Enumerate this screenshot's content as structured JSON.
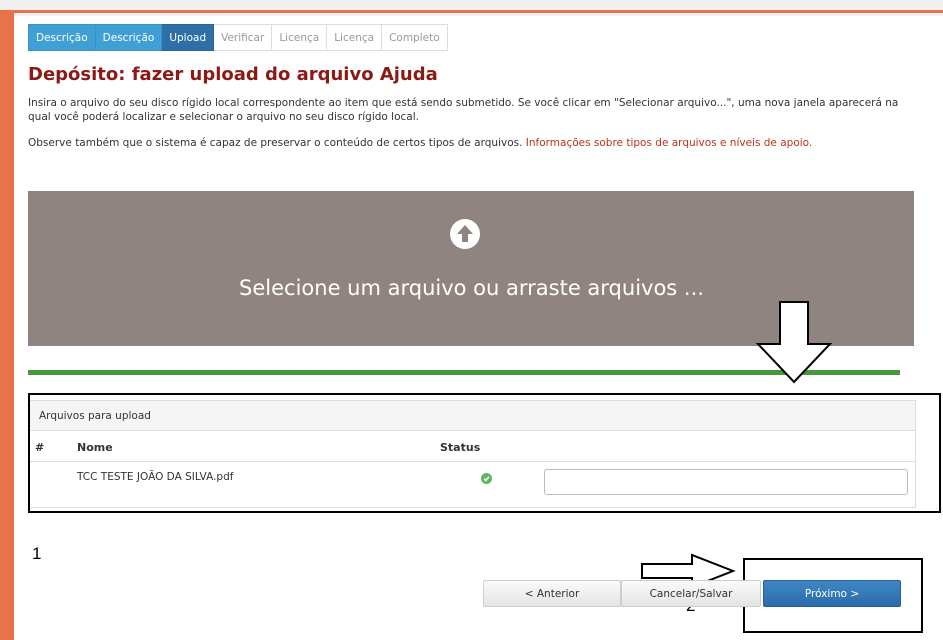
{
  "steps": [
    {
      "label": "Descrição",
      "state": "done"
    },
    {
      "label": "Descrição",
      "state": "done"
    },
    {
      "label": "Upload",
      "state": "active"
    },
    {
      "label": "Verificar",
      "state": "todo"
    },
    {
      "label": "Licença",
      "state": "todo"
    },
    {
      "label": "Licença",
      "state": "todo"
    },
    {
      "label": "Completo",
      "state": "todo"
    }
  ],
  "page_title": "Depósito: fazer upload do arquivo Ajuda",
  "intro_text": "Insira o arquivo do seu disco rígido local correspondente ao item que está sendo submetido. Se você clicar em \"Selecionar arquivo...\", uma nova janela aparecerá na qual você poderá localizar e selecionar o arquivo no seu disco rígido local.",
  "note_text": "Observe também que o sistema é capaz de preservar o conteúdo de certos tipos de arquivos.",
  "note_link": "Informações sobre tipos de arquivos e níveis de apoio.",
  "dropzone": {
    "icon": "upload-circle-icon",
    "text": "Selecione um arquivo ou arraste arquivos ..."
  },
  "upload_progress": 1.0,
  "files_panel": {
    "title": "Arquivos para upload",
    "columns": [
      "#",
      "Nome",
      "Status"
    ],
    "rows": [
      {
        "name": "TCC TESTE JOÃO DA SILVA.pdf",
        "status_icon": "check-circle-icon",
        "description_value": ""
      }
    ]
  },
  "buttons": {
    "previous": "< Anterior",
    "save": "Cancelar/Salvar",
    "next": "Próximo >"
  },
  "annotations": {
    "label_1": "1",
    "label_2": "2"
  },
  "colors": {
    "tab_done": "#3fa0d6",
    "tab_active": "#2f6fa7",
    "title": "#8b1a17",
    "link": "#b8321e",
    "dropzone": "#8f8480",
    "progress": "#45983e",
    "primary_button": "#2f6fa7",
    "frame_accent": "#e8734a"
  }
}
